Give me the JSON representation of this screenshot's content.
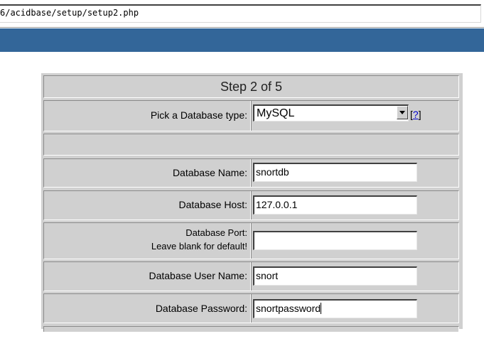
{
  "browser": {
    "url": "6/acidbase/setup/setup2.php"
  },
  "header": {
    "bar_color": "#336699"
  },
  "form": {
    "step_title": "Step 2 of 5",
    "db_type_label": "Pick a Database type:",
    "db_type_value": "MySQL",
    "help_link": "?",
    "db_name_label": "Database Name:",
    "db_name_value": "snortdb",
    "db_host_label": "Database Host:",
    "db_host_value": "127.0.0.1",
    "db_port_label_line1": "Database Port:",
    "db_port_label_line2": "Leave blank for default!",
    "db_port_value": "",
    "db_user_label": "Database User Name:",
    "db_user_value": "snort",
    "db_pass_label": "Database Password:",
    "db_pass_value": "snortpassword"
  }
}
